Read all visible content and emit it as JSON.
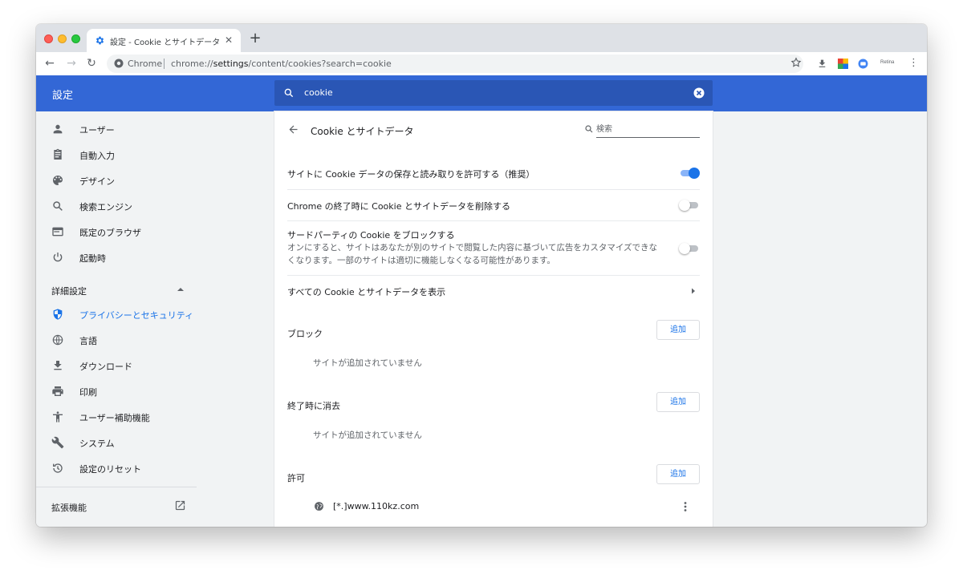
{
  "tab": {
    "title": "設定 - Cookie とサイトデータ",
    "close": "✕",
    "new_tab": "+"
  },
  "toolbar": {
    "back": "←",
    "forward": "→",
    "reload": "↻",
    "omnibox_label": "Chrome",
    "url_prefix": "chrome://",
    "url_host": "settings",
    "url_path": "/content/cookies?search=cookie",
    "extensions": [
      "download-icon",
      "apps-icon",
      "profile-icon",
      "retina-extension-icon",
      "menu-icon"
    ],
    "retina_label": "Retina",
    "menu": "⋮"
  },
  "header": {
    "title": "設定",
    "search_value": "cookie",
    "bg_color": "#3367d6"
  },
  "sidebar": {
    "items": [
      {
        "label": "ユーザー",
        "icon": "person-icon"
      },
      {
        "label": "自動入力",
        "icon": "clipboard-icon"
      },
      {
        "label": "デザイン",
        "icon": "palette-icon"
      },
      {
        "label": "検索エンジン",
        "icon": "search-icon"
      },
      {
        "label": "既定のブラウザ",
        "icon": "browser-icon"
      },
      {
        "label": "起動時",
        "icon": "power-icon"
      }
    ],
    "advanced_label": "詳細設定",
    "advanced_items": [
      {
        "label": "プライバシーとセキュリティ",
        "icon": "shield-icon",
        "active": true
      },
      {
        "label": "言語",
        "icon": "globe-icon"
      },
      {
        "label": "ダウンロード",
        "icon": "download-icon"
      },
      {
        "label": "印刷",
        "icon": "printer-icon"
      },
      {
        "label": "ユーザー補助機能",
        "icon": "accessibility-icon"
      },
      {
        "label": "システム",
        "icon": "wrench-icon"
      },
      {
        "label": "設定のリセット",
        "icon": "history-icon"
      }
    ],
    "extensions_label": "拡張機能"
  },
  "main": {
    "title": "Cookie とサイトデータ",
    "search_placeholder": "検索",
    "settings": [
      {
        "label": "サイトに Cookie データの保存と読み取りを許可する（推奨）",
        "enabled": true
      },
      {
        "label": "Chrome の終了時に Cookie とサイトデータを削除する",
        "enabled": false
      },
      {
        "label": "サードパーティの Cookie をブロックする",
        "sublabel": "オンにすると、サイトはあなたが別のサイトで閲覧した内容に基づいて広告をカスタマイズできなくなります。一部のサイトは適切に機能しなくなる可能性があります。",
        "enabled": false
      }
    ],
    "see_all": "すべての Cookie とサイトデータを表示",
    "sections": [
      {
        "label": "ブロック",
        "add": "追加",
        "empty": "サイトが追加されていません"
      },
      {
        "label": "終了時に消去",
        "add": "追加",
        "empty": "サイトが追加されていません"
      },
      {
        "label": "許可",
        "add": "追加",
        "sites": [
          "[*.]www.110kz.com"
        ]
      }
    ]
  },
  "colors": {
    "accent": "#1a73e8",
    "header": "#3367d6",
    "search_bar": "#2a56b5"
  }
}
